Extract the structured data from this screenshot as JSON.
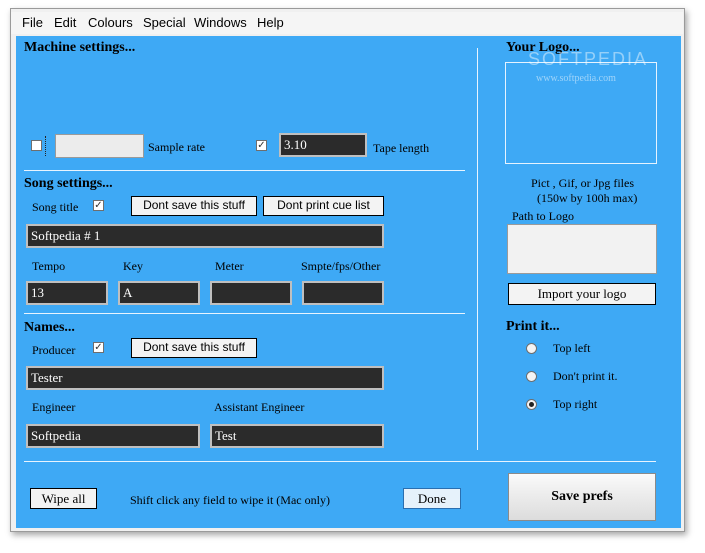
{
  "menu": [
    "File",
    "Edit",
    "Colours",
    "Special",
    "Windows",
    "Help"
  ],
  "machine": {
    "heading": "Machine settings...",
    "sample_rate_checked": false,
    "sample_rate_value": "",
    "sample_rate_label": "Sample rate",
    "tape_length_checked": true,
    "tape_length_value": "3.10",
    "tape_length_label": "Tape length"
  },
  "song": {
    "heading": "Song settings...",
    "song_title_label": "Song title",
    "song_title_checked": true,
    "dont_save_label": "Dont save this stuff",
    "dont_print_cue_label": "Dont print cue list",
    "title_value": "Softpedia # 1",
    "tempo_label": "Tempo",
    "key_label": "Key",
    "meter_label": "Meter",
    "smpte_label": "Smpte/fps/Other",
    "tempo_value": "13",
    "key_value": "A",
    "meter_value": "",
    "smpte_value": ""
  },
  "names": {
    "heading": "Names...",
    "producer_label": "Producer",
    "producer_checked": true,
    "dont_save_label": "Dont save this stuff",
    "producer_value": "Tester",
    "engineer_label": "Engineer",
    "assistant_label": "Assistant Engineer",
    "engineer_value": "Softpedia",
    "assistant_value": "Test"
  },
  "logo": {
    "heading": "Your Logo...",
    "watermark": "SOFTPEDIA",
    "watermark_url": "www.softpedia.com",
    "formats_line1": "Pict , Gif, or Jpg files",
    "formats_line2": "(150w by 100h max)",
    "path_label": "Path to Logo",
    "path_value": "",
    "import_label": "Import your logo"
  },
  "print": {
    "heading": "Print it...",
    "options": [
      {
        "label": "Top left",
        "selected": false
      },
      {
        "label": "Don't print it.",
        "selected": false
      },
      {
        "label": "Top right",
        "selected": true
      }
    ]
  },
  "footer": {
    "wipe_all_label": "Wipe all",
    "hint": "Shift click any  field to wipe it (Mac only)",
    "done_label": "Done",
    "save_prefs_label": "Save prefs"
  },
  "colors": {
    "panel": "#3ea9f5",
    "field": "#2b2b2b"
  }
}
